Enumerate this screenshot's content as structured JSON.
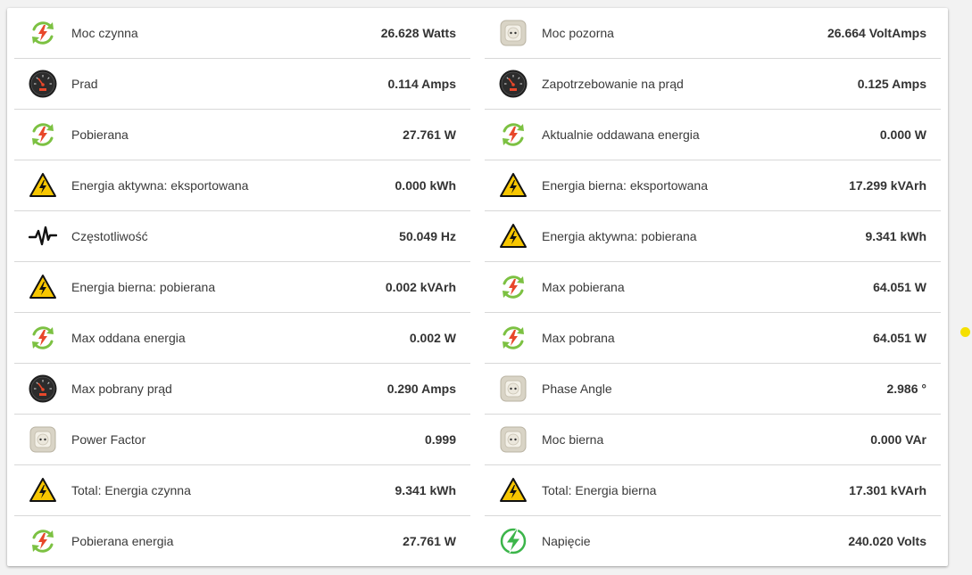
{
  "left": [
    {
      "label": "Moc czynna",
      "value": "26.628 Watts",
      "icon": "cycle-energy-icon"
    },
    {
      "label": "Prad",
      "value": "0.114 Amps",
      "icon": "gauge-icon"
    },
    {
      "label": "Pobierana",
      "value": "27.761 W",
      "icon": "cycle-energy-icon"
    },
    {
      "label": "Energia aktywna: eksportowana",
      "value": "0.000 kWh",
      "icon": "warning-icon"
    },
    {
      "label": "Częstotliwość",
      "value": "50.049 Hz",
      "icon": "waveform-icon"
    },
    {
      "label": "Energia bierna: pobierana",
      "value": "0.002 kVArh",
      "icon": "warning-icon"
    },
    {
      "label": "Max oddana energia",
      "value": "0.002 W",
      "icon": "cycle-energy-icon"
    },
    {
      "label": "Max pobrany prąd",
      "value": "0.290 Amps",
      "icon": "gauge-icon"
    },
    {
      "label": "Power Factor",
      "value": "0.999",
      "icon": "socket-icon"
    },
    {
      "label": "Total: Energia czynna",
      "value": "9.341 kWh",
      "icon": "warning-icon"
    },
    {
      "label": "Pobierana energia",
      "value": "27.761 W",
      "icon": "cycle-energy-icon"
    }
  ],
  "right": [
    {
      "label": "Moc pozorna",
      "value": "26.664 VoltAmps",
      "icon": "socket-icon"
    },
    {
      "label": "Zapotrzebowanie na prąd",
      "value": "0.125 Amps",
      "icon": "gauge-icon"
    },
    {
      "label": "Aktualnie oddawana energia",
      "value": "0.000 W",
      "icon": "cycle-energy-icon"
    },
    {
      "label": "Energia bierna: eksportowana",
      "value": "17.299 kVArh",
      "icon": "warning-icon"
    },
    {
      "label": "Energia aktywna: pobierana",
      "value": "9.341 kWh",
      "icon": "warning-icon"
    },
    {
      "label": "Max pobierana",
      "value": "64.051 W",
      "icon": "cycle-energy-icon"
    },
    {
      "label": "Max pobrana",
      "value": "64.051 W",
      "icon": "cycle-energy-icon"
    },
    {
      "label": "Phase Angle",
      "value": "2.986 °",
      "icon": "socket-icon"
    },
    {
      "label": "Moc bierna",
      "value": "0.000 VAr",
      "icon": "socket-icon"
    },
    {
      "label": "Total: Energia bierna",
      "value": "17.301 kVArh",
      "icon": "warning-icon"
    },
    {
      "label": "Napięcie",
      "value": "240.020 Volts",
      "icon": "lightning-icon"
    }
  ],
  "colors": {
    "cycle_green": "#7cc142",
    "bolt_red": "#e8482b",
    "warning_yellow": "#f7c600",
    "lightning_green": "#3cb54a",
    "dot_yellow": "#f5e000"
  }
}
